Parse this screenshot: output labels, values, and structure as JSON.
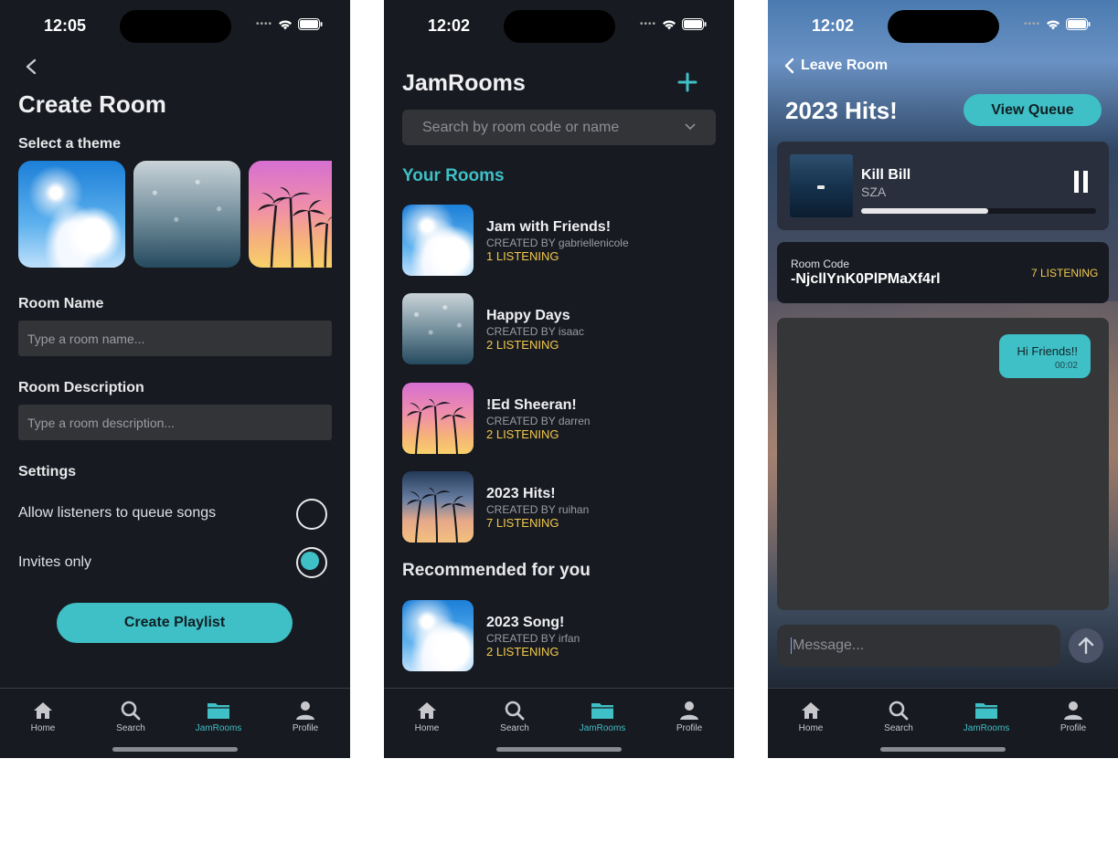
{
  "status": {
    "time_left": "12:05",
    "time_mid": "12:02",
    "time_right": "12:02"
  },
  "create": {
    "title": "Create Room",
    "theme_label": "Select a theme",
    "room_name_label": "Room Name",
    "room_name_placeholder": "Type a room name...",
    "desc_label": "Room Description",
    "desc_placeholder": "Type a room description...",
    "settings_label": "Settings",
    "opt_queue": "Allow listeners to queue songs",
    "opt_invites": "Invites only",
    "opt_queue_on": false,
    "opt_invites_on": true,
    "submit": "Create Playlist"
  },
  "rooms": {
    "title": "JamRooms",
    "search_placeholder": "Search by room code or name",
    "your_rooms_label": "Your Rooms",
    "recommended_label": "Recommended for you",
    "your_rooms": [
      {
        "name": "Jam with Friends!",
        "by": "CREATED BY gabriellenicole",
        "listening": "1 LISTENING",
        "theme": "sky"
      },
      {
        "name": "Happy Days",
        "by": "CREATED BY isaac",
        "listening": "2 LISTENING",
        "theme": "rain"
      },
      {
        "name": "!Ed Sheeran!",
        "by": "CREATED BY darren",
        "listening": "2 LISTENING",
        "theme": "sunset"
      },
      {
        "name": "2023 Hits!",
        "by": "CREATED BY ruihan",
        "listening": "7 LISTENING",
        "theme": "dusk"
      }
    ],
    "recommended": [
      {
        "name": "2023 Song!",
        "by": "CREATED BY irfan",
        "listening": "2 LISTENING",
        "theme": "sky"
      }
    ]
  },
  "room": {
    "back_label": "Leave Room",
    "title": "2023 Hits!",
    "view_queue": "View Queue",
    "track": "Kill Bill",
    "artist": "SZA",
    "progress": 0.54,
    "code_label": "Room Code",
    "code": "-NjcllYnK0PlPMaXf4rl",
    "listening": "7 LISTENING",
    "message_text": "Hi Friends!!",
    "message_time": "00:02",
    "input_placeholder": "Message..."
  },
  "tabs": [
    "Home",
    "Search",
    "JamRooms",
    "Profile"
  ],
  "active_tab": "JamRooms",
  "colors": {
    "accent": "#3fbfc6",
    "listening": "#f2c94c",
    "background": "#171a21"
  }
}
